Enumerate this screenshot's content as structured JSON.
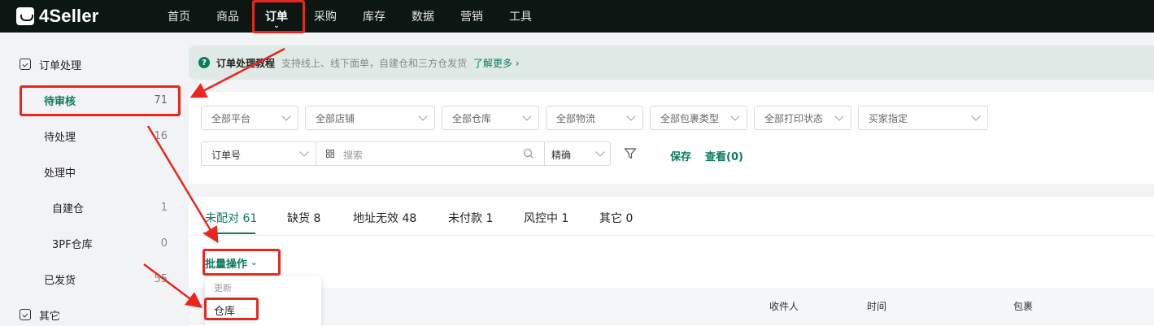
{
  "app": {
    "logo": "4Seller"
  },
  "nav": [
    "首页",
    "商品",
    "订单",
    "采购",
    "库存",
    "数据",
    "营销",
    "工具"
  ],
  "sidebar": {
    "group1": "订单处理",
    "items": [
      {
        "label": "待审核",
        "count": "71"
      },
      {
        "label": "待处理",
        "count": "16"
      },
      {
        "label": "处理中",
        "count": ""
      },
      {
        "label": "自建仓",
        "count": "1"
      },
      {
        "label": "3PF仓库",
        "count": "0"
      },
      {
        "label": "已发货",
        "count": "55"
      }
    ],
    "group2": "其它"
  },
  "banner": {
    "title": "订单处理教程",
    "desc": "支持线上、线下面单，自建仓和三方仓发货",
    "link": "了解更多 ›"
  },
  "filters": {
    "platform": "全部平台",
    "store": "全部店铺",
    "warehouse": "全部仓库",
    "logistics": "全部物流",
    "package": "全部包裹类型",
    "print": "全部打印状态",
    "buyer": "买家指定",
    "order_field": "订单号",
    "search_placeholder": "搜索",
    "match": "精确",
    "save": "保存",
    "view": "查看(0)"
  },
  "tabs": [
    "未配对 61",
    "缺货 8",
    "地址无效 48",
    "未付款 1",
    "风控中 1",
    "其它 0"
  ],
  "batch": {
    "label": "批量操作"
  },
  "dropdown": {
    "header": "更新",
    "item": "仓库"
  },
  "table": {
    "headers": [
      "收件人",
      "时间",
      "包裹"
    ]
  }
}
